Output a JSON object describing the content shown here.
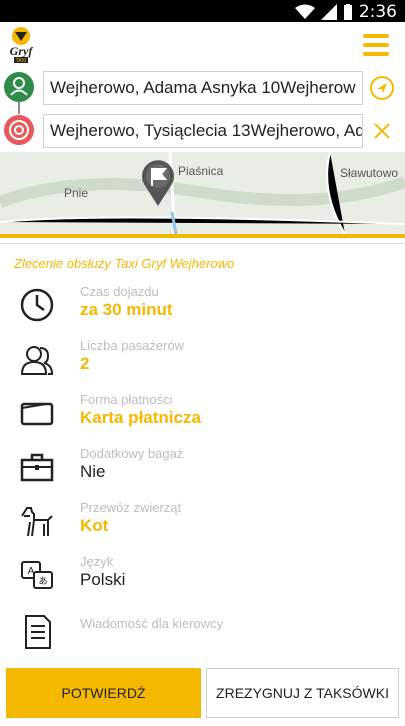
{
  "status": {
    "time": "2:36"
  },
  "header": {
    "logo_icon": "gryf-taxi-logo",
    "menu_icon": "hamburger-menu-icon",
    "brand_color": "#f5b800"
  },
  "route": {
    "from": {
      "value": "Wejherowo, Adama Asnyka 10Wejherow"
    },
    "to": {
      "value": "Wejherowo, Tysiąclecia 13Wejherowo, Ad"
    }
  },
  "map": {
    "labels": [
      "Piaśnica",
      "Pnie",
      "Sławutowo"
    ]
  },
  "order": {
    "title": "Zlecenie obsłuży Taxi Gryf Wejherowo",
    "items": [
      {
        "label": "Czas dojazdu",
        "value": "za 30 minut",
        "icon": "clock-icon",
        "highlight": true
      },
      {
        "label": "Liczba pasażerów",
        "value": "2",
        "icon": "passengers-icon",
        "highlight": true
      },
      {
        "label": "Forma płatności",
        "value": "Karta płatnicza",
        "icon": "wallet-icon",
        "highlight": true
      },
      {
        "label": "Dodatkowy bagaż",
        "value": "Nie",
        "icon": "luggage-icon",
        "highlight": false
      },
      {
        "label": "Przewóz zwierząt",
        "value": "Kot",
        "icon": "dog-icon",
        "highlight": true
      },
      {
        "label": "Język",
        "value": "Polski",
        "icon": "language-icon",
        "highlight": false
      },
      {
        "label": "Wiadomość dla kierowcy",
        "value": "",
        "icon": "message-icon",
        "highlight": false
      }
    ]
  },
  "buttons": {
    "confirm": "POTWIERDŹ",
    "cancel": "ZREZYGNUJ Z TAKSÓWKI"
  }
}
